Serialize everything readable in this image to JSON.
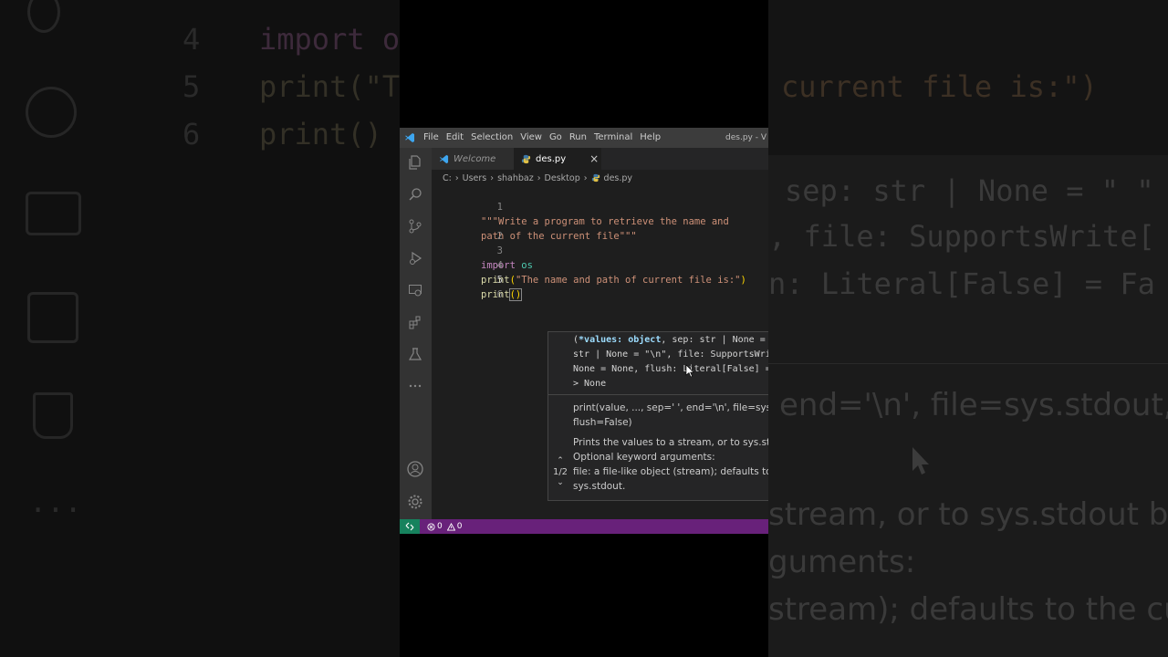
{
  "background": {
    "left_line_numbers": [
      "4",
      "5",
      "6"
    ],
    "left_code": [
      "import o",
      "print(\"T",
      "print()"
    ],
    "right_code": [
      "current file is:\")",
      "sep: str | None = \" \"",
      ", file: SupportsWrite[",
      "n: Literal[False] = Fa"
    ],
    "right_doc": [
      "end='\\n', file=sys.stdout,",
      "stream, or to sys.stdout by",
      "guments:",
      "stream); defaults to the cur"
    ]
  },
  "titlebar": {
    "menus": [
      "File",
      "Edit",
      "Selection",
      "View",
      "Go",
      "Run",
      "Terminal",
      "Help"
    ],
    "window_title": "des.py - V"
  },
  "tabs": [
    {
      "label": "Welcome",
      "icon": "vscode-logo-icon"
    },
    {
      "label": "des.py",
      "icon": "python-icon",
      "close": "×"
    }
  ],
  "breadcrumb": [
    "C:",
    "Users",
    "shahbaz",
    "Desktop",
    "des.py"
  ],
  "breadcrumb_sep": "›",
  "code": {
    "lines": [
      {
        "n": "1",
        "text": "\"\"\"Write a program to retrieve the name and"
      },
      {
        "n": "",
        "text": "path of the current file\"\"\""
      },
      {
        "n": "2",
        "text": ""
      },
      {
        "n": "3",
        "text": ""
      },
      {
        "n": "4",
        "kw": "import",
        "mod": "os"
      },
      {
        "n": "5",
        "fn": "print",
        "str": "\"The name and path of current file is:\""
      },
      {
        "n": "6",
        "fn": "print",
        "args": "()"
      }
    ]
  },
  "hover": {
    "signature": [
      "(*values: object, sep: str | None = \" \",",
      "str | None = \"\\n\", file: SupportsWrite[",
      "None = None, flush: Literal[False] = Fa",
      "> None"
    ],
    "param": "*values: object",
    "usage": [
      "print(value, ..., sep=' ', end='\\n', file=sys.stdout,",
      "flush=False)"
    ],
    "doc": [
      "Prints the values to a stream, or to sys.stdout by",
      "Optional keyword arguments:",
      "file: a file-like object (stream); defaults to the cur",
      "sys.stdout."
    ],
    "pager": "1/2",
    "up": "⌃",
    "down": "⌄"
  },
  "status": {
    "errors": "0",
    "warnings": "0"
  },
  "colors": {
    "statusbar": "#68217a",
    "remote": "#16825d",
    "titlebar": "#3c3c3c",
    "editor": "#1e1e1e"
  }
}
